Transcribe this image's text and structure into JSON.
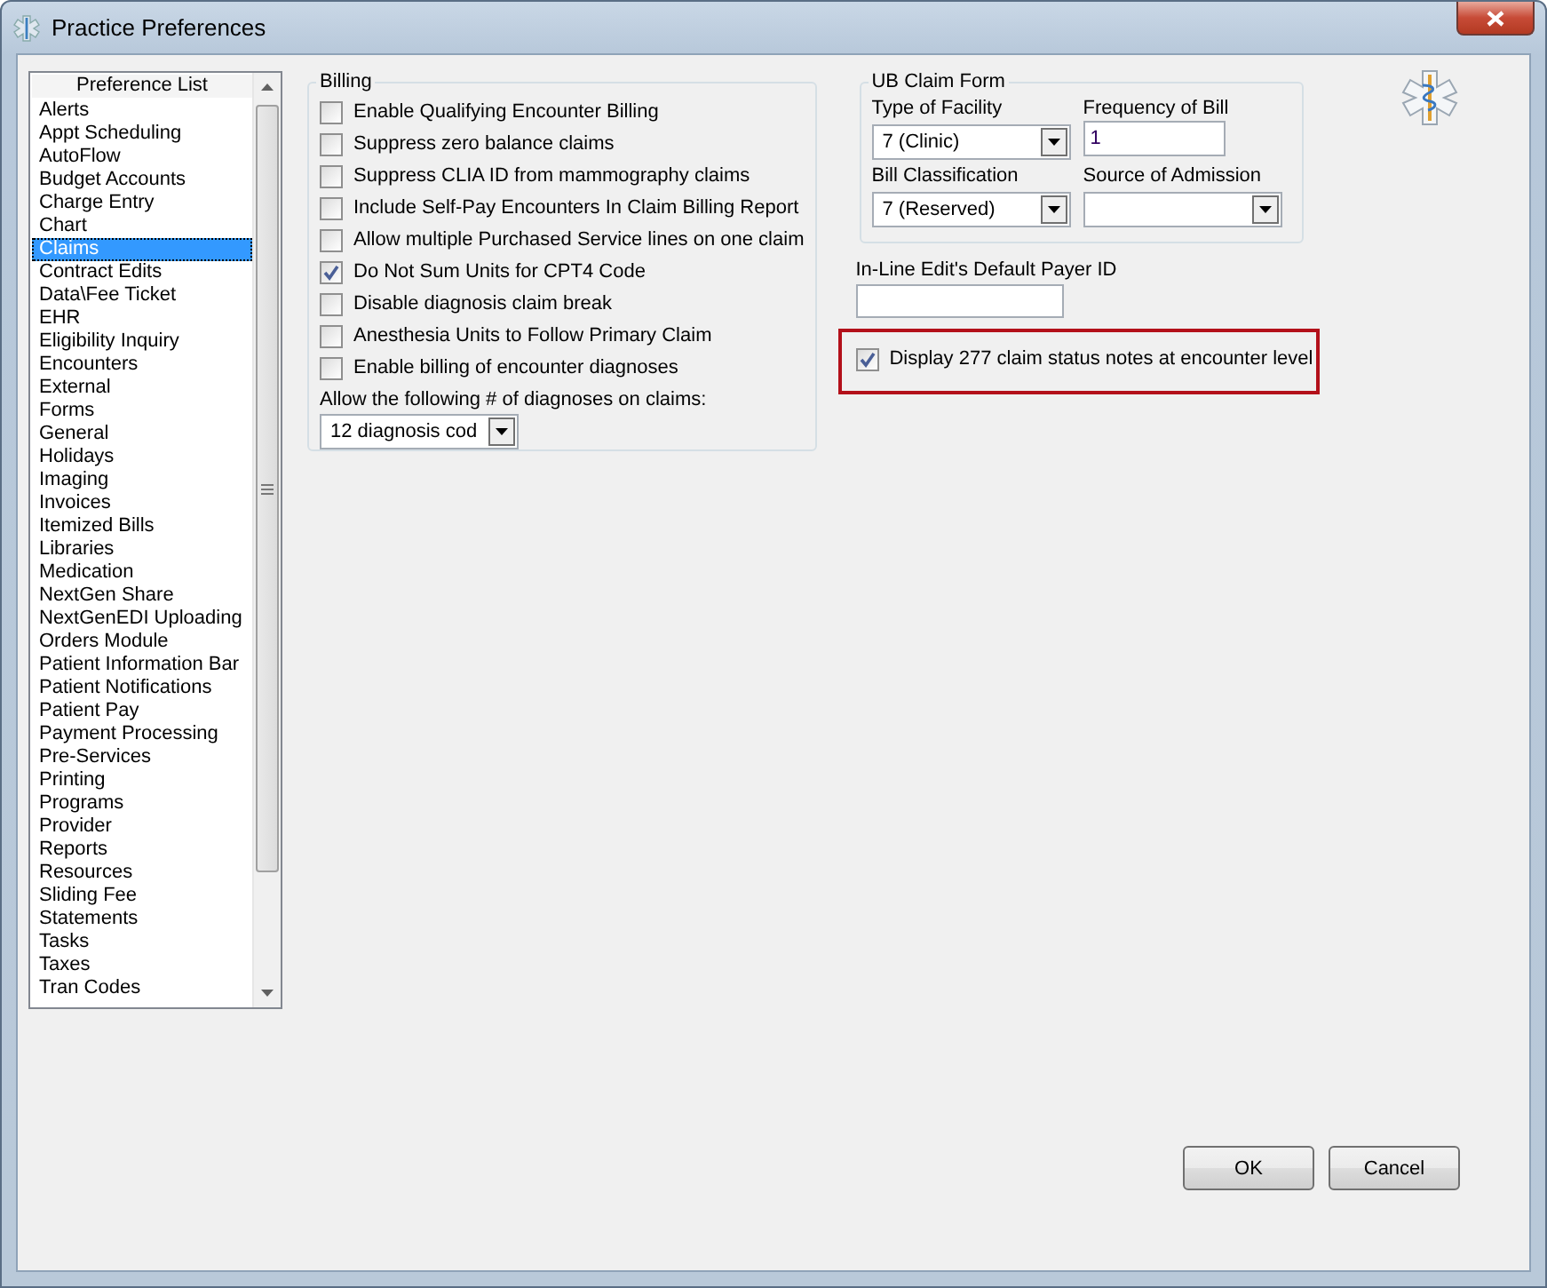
{
  "window": {
    "title": "Practice Preferences"
  },
  "preference_list": {
    "header": "Preference List",
    "items": [
      {
        "label": "Alerts",
        "selected": false
      },
      {
        "label": "Appt Scheduling",
        "selected": false
      },
      {
        "label": "AutoFlow",
        "selected": false
      },
      {
        "label": "Budget Accounts",
        "selected": false
      },
      {
        "label": "Charge Entry",
        "selected": false
      },
      {
        "label": "Chart",
        "selected": false
      },
      {
        "label": "Claims",
        "selected": true
      },
      {
        "label": "Contract Edits",
        "selected": false
      },
      {
        "label": "Data\\Fee Ticket",
        "selected": false
      },
      {
        "label": "EHR",
        "selected": false
      },
      {
        "label": "Eligibility Inquiry",
        "selected": false
      },
      {
        "label": "Encounters",
        "selected": false
      },
      {
        "label": "External",
        "selected": false
      },
      {
        "label": "Forms",
        "selected": false
      },
      {
        "label": "General",
        "selected": false
      },
      {
        "label": "Holidays",
        "selected": false
      },
      {
        "label": "Imaging",
        "selected": false
      },
      {
        "label": "Invoices",
        "selected": false
      },
      {
        "label": "Itemized Bills",
        "selected": false
      },
      {
        "label": "Libraries",
        "selected": false
      },
      {
        "label": "Medication",
        "selected": false
      },
      {
        "label": "NextGen Share",
        "selected": false
      },
      {
        "label": "NextGenEDI Uploading",
        "selected": false
      },
      {
        "label": "Orders Module",
        "selected": false
      },
      {
        "label": "Patient Information Bar",
        "selected": false
      },
      {
        "label": "Patient Notifications",
        "selected": false
      },
      {
        "label": "Patient Pay",
        "selected": false
      },
      {
        "label": "Payment Processing",
        "selected": false
      },
      {
        "label": "Pre-Services",
        "selected": false
      },
      {
        "label": "Printing",
        "selected": false
      },
      {
        "label": "Programs",
        "selected": false
      },
      {
        "label": "Provider",
        "selected": false
      },
      {
        "label": "Reports",
        "selected": false
      },
      {
        "label": "Resources",
        "selected": false
      },
      {
        "label": "Sliding Fee",
        "selected": false
      },
      {
        "label": "Statements",
        "selected": false
      },
      {
        "label": "Tasks",
        "selected": false
      },
      {
        "label": "Taxes",
        "selected": false
      },
      {
        "label": "Tran Codes",
        "selected": false
      }
    ]
  },
  "billing": {
    "title": "Billing",
    "options": [
      {
        "label": "Enable Qualifying Encounter Billing",
        "checked": false
      },
      {
        "label": "Suppress zero balance claims",
        "checked": false
      },
      {
        "label": "Suppress CLIA ID from mammography claims",
        "checked": false
      },
      {
        "label": "Include Self-Pay Encounters In Claim Billing Report",
        "checked": false
      },
      {
        "label": "Allow multiple Purchased Service lines on one claim",
        "checked": false
      },
      {
        "label": "Do Not Sum Units for CPT4 Code",
        "checked": true
      },
      {
        "label": "Disable diagnosis claim break",
        "checked": false
      },
      {
        "label": "Anesthesia Units to Follow Primary Claim",
        "checked": false
      },
      {
        "label": "Enable billing of encounter diagnoses",
        "checked": false
      }
    ],
    "diagnoses_label": "Allow the following # of diagnoses on claims:",
    "diagnoses_value": "12 diagnosis cod"
  },
  "ub_claim_form": {
    "title": "UB Claim Form",
    "fields": [
      {
        "label": "Type of Facility",
        "value": "7  (Clinic)",
        "kind": "dropdown"
      },
      {
        "label": "Frequency of Bill",
        "value": "1",
        "kind": "text"
      },
      {
        "label": "Bill Classification",
        "value": "7  (Reserved)",
        "kind": "dropdown"
      },
      {
        "label": "Source of Admission",
        "kind": "dropdown"
      }
    ]
  },
  "default_payer": {
    "label": "In-Line Edit's Default Payer ID"
  },
  "highlighted_option": {
    "label": "Display 277 claim status notes at encounter level",
    "checked": true
  },
  "buttons": [
    "OK",
    "Cancel"
  ]
}
